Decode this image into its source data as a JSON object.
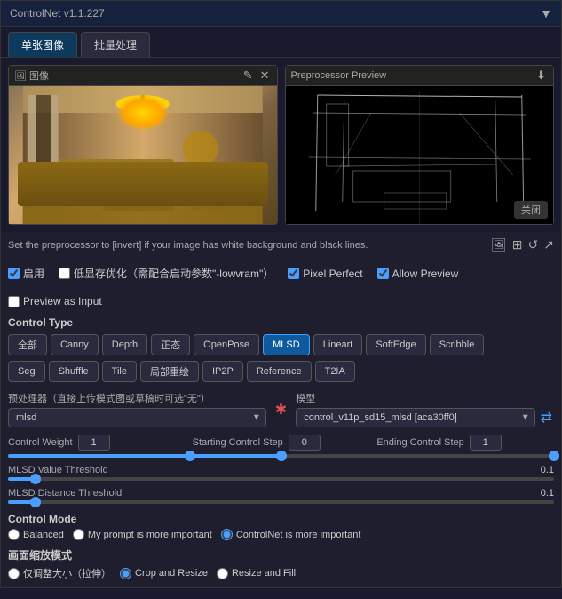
{
  "app": {
    "title": "ControlNet v1.1.227",
    "dropdown_arrow": "▼"
  },
  "tabs": [
    {
      "label": "单张图像",
      "active": true
    },
    {
      "label": "批量处理",
      "active": false
    }
  ],
  "image_panel": {
    "label": "图像",
    "close_icon": "✕",
    "upload_icon": "⬆",
    "edit_icon": "✎"
  },
  "preprocessor_panel": {
    "label": "Preprocessor Preview",
    "close_label": "关闭",
    "download_icon": "⬇"
  },
  "info_text": "Set the preprocessor to [invert] if your image has white background and black lines.",
  "checkboxes": {
    "enable": {
      "label": "启用",
      "checked": true
    },
    "low_vram": {
      "label": "低显存优化（需配合启动参数\"-lowvram\"）",
      "checked": false
    },
    "pixel_perfect": {
      "label": "Pixel Perfect",
      "checked": true
    },
    "allow_preview": {
      "label": "Allow Preview",
      "checked": true
    },
    "preview_as_input": {
      "label": "Preview as Input",
      "checked": false
    }
  },
  "control_type": {
    "label": "Control Type",
    "buttons": [
      {
        "label": "全部",
        "active": false
      },
      {
        "label": "Canny",
        "active": false
      },
      {
        "label": "Depth",
        "active": false
      },
      {
        "label": "正态",
        "active": false
      },
      {
        "label": "OpenPose",
        "active": false
      },
      {
        "label": "MLSD",
        "active": true
      },
      {
        "label": "Lineart",
        "active": false
      },
      {
        "label": "SoftEdge",
        "active": false
      },
      {
        "label": "Scribble",
        "active": false
      },
      {
        "label": "Seg",
        "active": false
      },
      {
        "label": "Shuffle",
        "active": false
      },
      {
        "label": "Tile",
        "active": false
      },
      {
        "label": "局部重绘",
        "active": false
      },
      {
        "label": "IP2P",
        "active": false
      },
      {
        "label": "Reference",
        "active": false
      },
      {
        "label": "T2IA",
        "active": false
      }
    ]
  },
  "preprocessor": {
    "label": "预处理器（直接上传模式图或草稿时可选\"无\"）",
    "value": "mlsd",
    "refresh_icon": "✱"
  },
  "model": {
    "label": "模型",
    "value": "control_v11p_sd15_mlsd [aca30ff0]",
    "swap_icon": "⇄"
  },
  "control_weight": {
    "label": "Control Weight",
    "value": "1",
    "slider_percent": 50
  },
  "starting_step": {
    "label": "Starting Control Step",
    "value": "0",
    "slider_percent": 0
  },
  "ending_step": {
    "label": "Ending Control Step",
    "value": "1",
    "slider_percent": 100
  },
  "mlsd_value": {
    "label": "MLSD Value Threshold",
    "value": "0.1",
    "slider_percent": 5
  },
  "mlsd_distance": {
    "label": "MLSD Distance Threshold",
    "value": "0.1",
    "slider_percent": 5
  },
  "control_mode": {
    "label": "Control Mode",
    "options": [
      {
        "label": "Balanced",
        "selected": false
      },
      {
        "label": "My prompt is more important",
        "selected": false
      },
      {
        "label": "ControlNet is more important",
        "selected": true
      }
    ]
  },
  "resize_mode": {
    "label": "画面缩放模式",
    "options": [
      {
        "label": "仅调整大小（拉伸）",
        "selected": false
      },
      {
        "label": "Crop and Resize",
        "selected": true
      },
      {
        "label": "Resize and Fill",
        "selected": false
      }
    ]
  }
}
